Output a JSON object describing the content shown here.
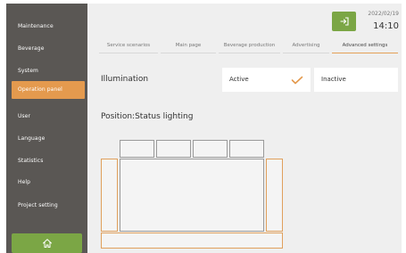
{
  "sidebar": {
    "items": [
      {
        "label": "Maintenance"
      },
      {
        "label": "Beverage"
      },
      {
        "label": "System"
      },
      {
        "label": "Operation panel"
      },
      {
        "label": "User"
      },
      {
        "label": "Language"
      },
      {
        "label": "Statistics"
      },
      {
        "label": "Help"
      },
      {
        "label": "Project setting"
      }
    ],
    "active_index": 3,
    "home_icon": "home-icon"
  },
  "header": {
    "date": "2022/02/19",
    "time": "14:10",
    "logout_icon": "logout-icon"
  },
  "tabs": [
    {
      "label": "Service scenarios"
    },
    {
      "label": "Main page"
    },
    {
      "label": "Beverage production"
    },
    {
      "label": "Advertising"
    },
    {
      "label": "Advanced settings"
    }
  ],
  "active_tab_index": 4,
  "illumination": {
    "label": "Illumination",
    "options": [
      {
        "label": "Active",
        "selected": true
      },
      {
        "label": "Inactive",
        "selected": false
      }
    ]
  },
  "position": {
    "label": "Position:Status lighting"
  },
  "colors": {
    "sidebar_bg": "#5a5754",
    "active_orange": "#e49a4e",
    "green": "#7ba645",
    "main_bg": "#efefef"
  }
}
